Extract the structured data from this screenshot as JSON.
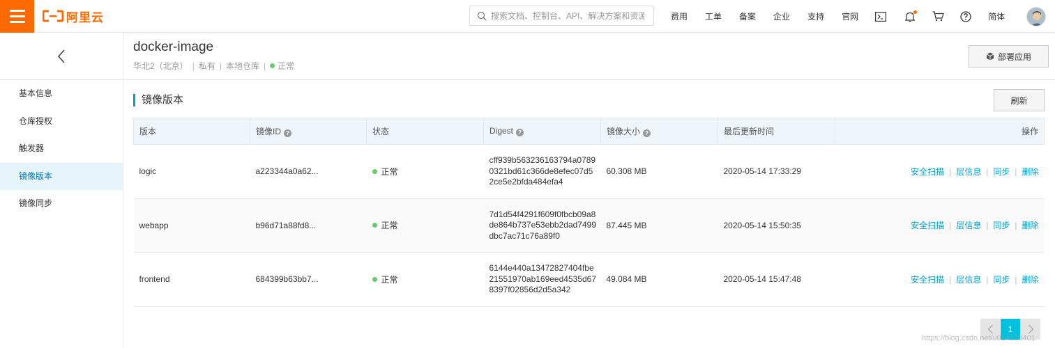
{
  "brand": {
    "logo_text": "阿里云",
    "accent": "#ff6a00"
  },
  "search": {
    "placeholder": "搜索文档、控制台、API、解决方案和资源"
  },
  "topnav": {
    "items": [
      "费用",
      "工单",
      "备案",
      "企业",
      "支持",
      "官网"
    ],
    "language": "简体"
  },
  "sidebar": {
    "items": [
      {
        "label": "基本信息"
      },
      {
        "label": "仓库授权"
      },
      {
        "label": "触发器"
      },
      {
        "label": "镜像版本",
        "active": true
      },
      {
        "label": "镜像同步"
      }
    ]
  },
  "repo": {
    "title": "docker-image",
    "region": "华北2（北京）",
    "visibility": "私有",
    "source": "本地仓库",
    "status": "正常"
  },
  "actions": {
    "deploy_label": "部署应用",
    "refresh_label": "刷新"
  },
  "section": {
    "title": "镜像版本"
  },
  "table": {
    "headers": [
      "版本",
      "镜像ID",
      "状态",
      "Digest",
      "镜像大小",
      "最后更新时间",
      "操作"
    ],
    "rows": [
      {
        "version": "logic",
        "image_id": "a223344a0a62...",
        "status": "正常",
        "digest": "cff939b563236163794a07890321bd61c366de8efec07d52ce5e2bfda484efa4",
        "size": "60.308 MB",
        "updated": "2020-05-14 17:33:29"
      },
      {
        "version": "webapp",
        "image_id": "b96d71a88fd8...",
        "status": "正常",
        "digest": "7d1d54f4291f609f0fbcb09a8de864b737e53ebb2dad7499dbc7ac71c76a89f0",
        "size": "87.445 MB",
        "updated": "2020-05-14 15:50:35"
      },
      {
        "version": "frontend",
        "image_id": "684399b63bb7...",
        "status": "正常",
        "digest": "6144e440a13472827404fbe21551970ab169eed4535d678397f02856d2d5a342",
        "size": "49.084 MB",
        "updated": "2020-05-14 15:47:48"
      }
    ],
    "ops": [
      "安全扫描",
      "层信息",
      "同步",
      "删除"
    ]
  },
  "pagination": {
    "current": "1"
  },
  "watermark": "https://blog.csdn.net/u014120401",
  "colors": {
    "link": "#00a2ca",
    "status_ok": "#6bc96b",
    "active_bg": "#e6f4fb",
    "page_current": "#00c1de"
  }
}
